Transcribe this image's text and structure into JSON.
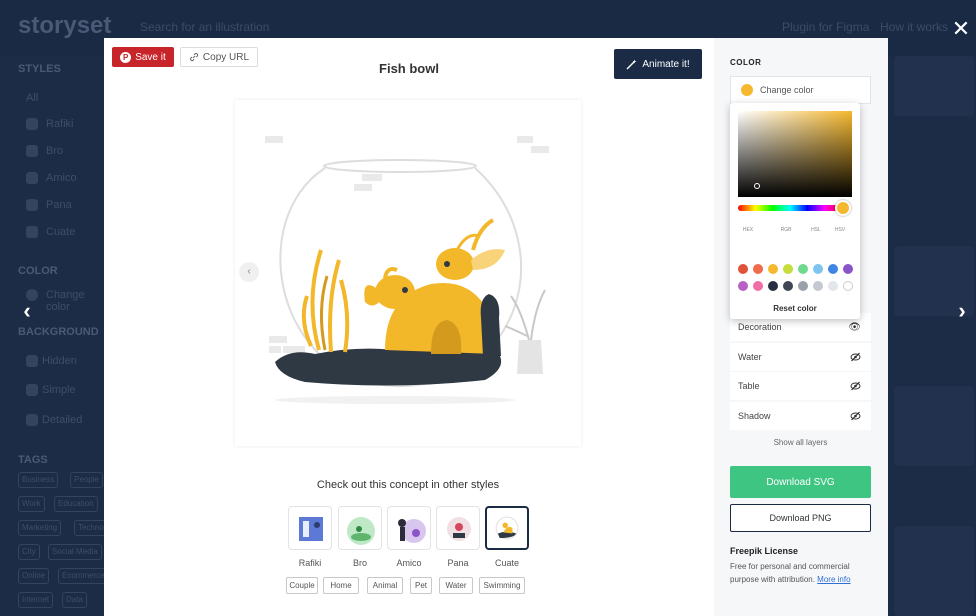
{
  "background": {
    "logo": "storyset",
    "search_placeholder": "Search for an illustration",
    "links": [
      "Plugin for Figma",
      "How it works"
    ],
    "sidebar": {
      "styles_heading": "STYLES",
      "styles": [
        "All",
        "Rafiki",
        "Bro",
        "Amico",
        "Pana",
        "Cuate"
      ],
      "color_heading": "COLOR",
      "change_color": "Change color",
      "background_heading": "BACKGROUND",
      "backgrounds": [
        "Hidden",
        "Simple",
        "Detailed"
      ],
      "tags_heading": "TAGS",
      "tags": [
        [
          "Business",
          "People"
        ],
        [
          "Work",
          "Education"
        ],
        [
          "Marketing",
          "Technology"
        ],
        [
          "City",
          "Social Media"
        ],
        [
          "Online",
          "Ecommerce"
        ],
        [
          "Internet",
          "Data"
        ]
      ]
    }
  },
  "modal": {
    "save_label": "Save it",
    "copy_label": "Copy URL",
    "title": "Fish bowl",
    "animate_label": "Animate it!",
    "styles_heading": "Check out this concept in other styles",
    "styles": [
      {
        "name": "Rafiki",
        "selected": false
      },
      {
        "name": "Bro",
        "selected": false
      },
      {
        "name": "Amico",
        "selected": false
      },
      {
        "name": "Pana",
        "selected": false
      },
      {
        "name": "Cuate",
        "selected": true
      }
    ],
    "tags": [
      "Couple",
      "Home",
      "Animal",
      "Pet",
      "Water",
      "Swimming"
    ]
  },
  "panel": {
    "color_heading": "COLOR",
    "change_color_label": "Change color",
    "selected_color": "#f5b82e",
    "layers": [
      {
        "name": "Decoration",
        "icon": "eye-icon"
      },
      {
        "name": "Water",
        "icon": "eye-slash-icon"
      },
      {
        "name": "Table",
        "icon": "eye-slash-icon"
      },
      {
        "name": "Shadow",
        "icon": "eye-slash-icon"
      }
    ],
    "show_layers": "Show all layers",
    "download_svg": "Download SVG",
    "download_png": "Download PNG",
    "license_heading": "Freepik License",
    "license_text": "Free for personal and commercial purpose with attribution.",
    "license_link": "More info"
  },
  "picker": {
    "formats": [
      "HEX",
      "RGB",
      "HSL",
      "HSV"
    ],
    "presets": [
      "#e0523a",
      "#ef6b4a",
      "#f5b82e",
      "#c6dd3d",
      "#6fd98d",
      "#7ec4ef",
      "#3f86e4",
      "#8a55c9",
      "#b960c6",
      "#ef6fa6",
      "#273040",
      "#3f4655",
      "#9aa1ab",
      "#c4c9cf",
      "#e3e6ea",
      "#ffffff"
    ],
    "reset_label": "Reset color"
  }
}
